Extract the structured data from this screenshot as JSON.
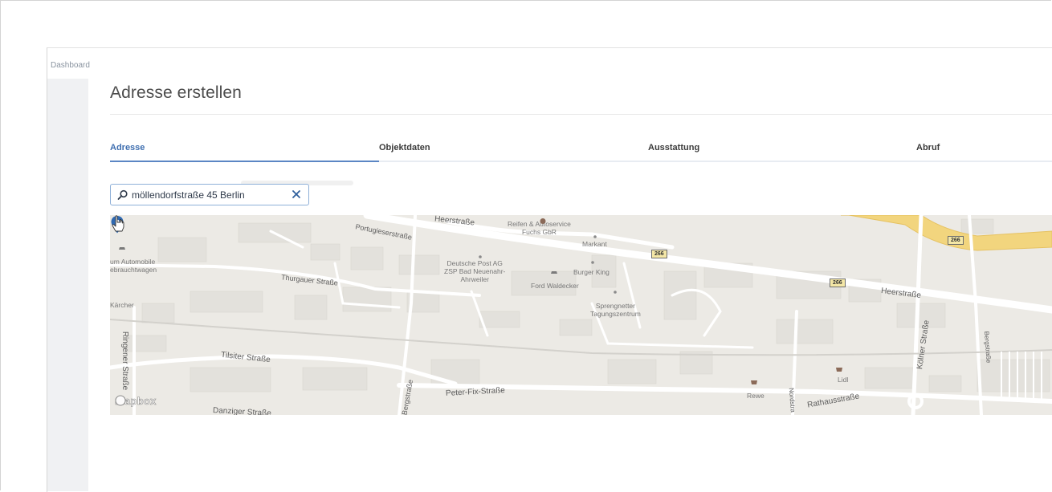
{
  "breadcrumb": "Dashboard",
  "page_title": "Adresse erstellen",
  "tabs": [
    {
      "label": "Adresse",
      "active": true
    },
    {
      "label": "Objektdaten",
      "active": false
    },
    {
      "label": "Ausstattung",
      "active": false
    },
    {
      "label": "Abruf",
      "active": false
    }
  ],
  "search": {
    "value": "möllendorfstraße 45 Berlin",
    "icon": "search-icon",
    "clear_icon": "close-icon"
  },
  "map": {
    "provider_logo": "mapbox",
    "streets": {
      "heerstrasse_1": "Heerstraße",
      "heerstrasse_2": "Heerstraße",
      "portugieserstrasse": "Portugieserstraße",
      "thurgauer": "Thurgauer Straße",
      "tilsiter": "Tilsiter Straße",
      "ringener": "Ringener Straße",
      "peter_fix": "Peter-Fix-Straße",
      "bergstrasse_1": "Bergstraße",
      "bergstrasse_2": "Bergstraße",
      "koelner": "Kölner Straße",
      "rathausstrasse": "Rathausstraße",
      "danziger": "Danziger Straße",
      "nordstr": "Nordstra"
    },
    "pois": {
      "reifen": "Reifen & Autoservice\nFuchs GbR",
      "markant": "Markant",
      "post": "Deutsche Post AG\nZSP Bad Neuenahr-\nAhrweiler",
      "burger_king": "Burger King",
      "ford": "Ford Waldecker",
      "sprengnetter": "Sprengnetter\nTagungszentrum",
      "automobile": "um Automobile\nebrauchtwagen",
      "kaercher": "Kärcher",
      "rewe": "Rewe",
      "lidl": "Lidl"
    },
    "road_shields": [
      "266",
      "266",
      "266"
    ],
    "colors": {
      "background": "#eceae5",
      "road": "#ffffff",
      "highway": "#f2d57e",
      "pin": "#2f69b1"
    }
  },
  "colors": {
    "accent": "#3f6fb0",
    "tab_underline": "#5b86c4",
    "nav_bg": "#f0f1f3"
  }
}
